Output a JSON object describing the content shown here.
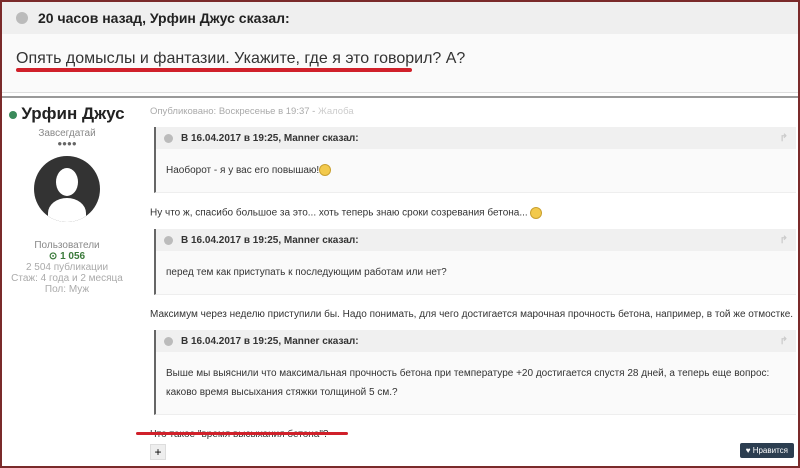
{
  "top": {
    "header": "20 часов назад, Урфин Джус сказал:",
    "body": "Опять домыслы и фантазии. Укажите, где я это говорил?  А?"
  },
  "user": {
    "name": "Урфин Джус",
    "rank": "Завсегдатай",
    "pips": "●●●●",
    "group": "Пользователи",
    "reputation": "1 056",
    "posts": "2 504 публикации",
    "tenure": "Стаж: 4 года и 2 месяца",
    "gender": "Пол: Муж"
  },
  "post": {
    "meta": "Опубликовано: Воскресенье в 19:37",
    "report": "Жалоба",
    "quotes": [
      {
        "header": "В 16.04.2017 в 19:25, Manner сказал:",
        "body": "Наоборот - я у вас его повышаю!"
      },
      {
        "header": "В 16.04.2017 в 19:25, Manner сказал:",
        "body": "перед тем как приступать к последующим работам или нет?"
      },
      {
        "header": "В 16.04.2017 в 19:25, Manner сказал:",
        "body": "Выше мы выяснили что максимальная прочность бетона при температуре +20 достигается спустя 28 дней, а теперь еще вопрос: каково время высыхания стяжки толщиной 5 см.?"
      }
    ],
    "replies": [
      "Ну что ж, спасибо большое за это...  хоть теперь знаю сроки созревания бетона...",
      "Максимум через неделю приступили бы. Надо понимать, для чего достигается марочная прочность бетона, например, в той же отмостке.",
      "Что такое \"время высыхания бетона\"?"
    ],
    "plus": "+",
    "like": "♥ Нравится"
  }
}
